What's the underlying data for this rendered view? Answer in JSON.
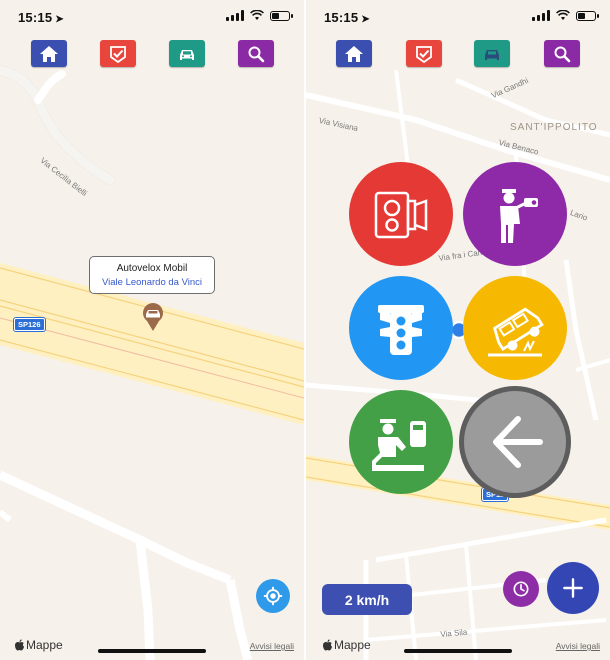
{
  "status": {
    "time": "15:15"
  },
  "left": {
    "callout": {
      "title": "Autovelox Mobil",
      "subtitle": "Viale Leonardo da Vinci"
    },
    "labels": {
      "road1": "Via Cecilia Bielli",
      "shield": "SP126"
    },
    "footer": {
      "maps": "Mappe",
      "legal": "Avvisi legali"
    }
  },
  "right": {
    "labels": {
      "area": "SANT'IPPOLITO",
      "road_gandhi": "Via Gandhi",
      "road_visiana": "Via Visiana",
      "road_benaco": "Via Benaco",
      "road_lario": "Lario",
      "road_campi": "Via fra i Campi",
      "road_sila": "Via Sila",
      "shield": "SP12"
    },
    "speed": "2 km/h",
    "footer": {
      "maps": "Mappe",
      "legal": "Avvisi legali"
    }
  },
  "colors": {
    "home": "#3a4fb0",
    "report": "#e8463d",
    "car": "#1f9a86",
    "search": "#8b2aa5",
    "fixed_camera": "#e53935",
    "police": "#8e2aa8",
    "traffic_light": "#2196f3",
    "accident": "#f6b800",
    "checkpoint": "#43a047"
  },
  "icons": [
    "home-icon",
    "checkmark-icon",
    "car-icon",
    "search-icon",
    "speed-camera-icon",
    "police-radar-icon",
    "traffic-light-icon",
    "car-accident-icon",
    "police-checkpoint-icon",
    "back-arrow-icon",
    "clock-icon",
    "plus-icon",
    "locate-icon"
  ]
}
